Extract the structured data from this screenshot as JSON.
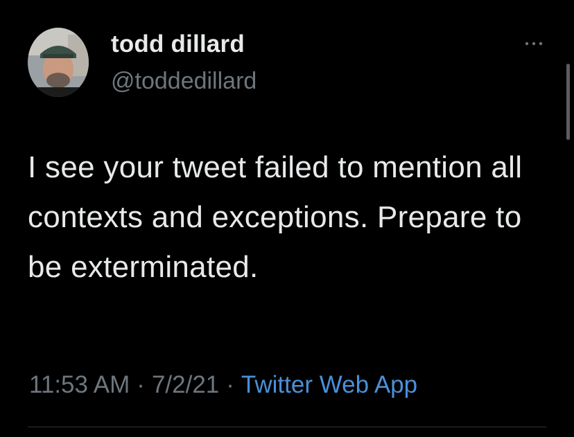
{
  "tweet": {
    "author": {
      "display_name": "todd dillard",
      "handle": "@toddedillard"
    },
    "text": "I see your tweet failed to mention all contexts and exceptions. Prepare to be exterminated.",
    "time": "11:53 AM",
    "date": "7/2/21",
    "source": "Twitter Web App",
    "separator": "·"
  },
  "icons": {
    "more": "more-horizontal-icon"
  },
  "colors": {
    "background": "#000000",
    "text_primary": "#e7e9ea",
    "text_secondary": "#6e767d",
    "link": "#4a90d9"
  }
}
